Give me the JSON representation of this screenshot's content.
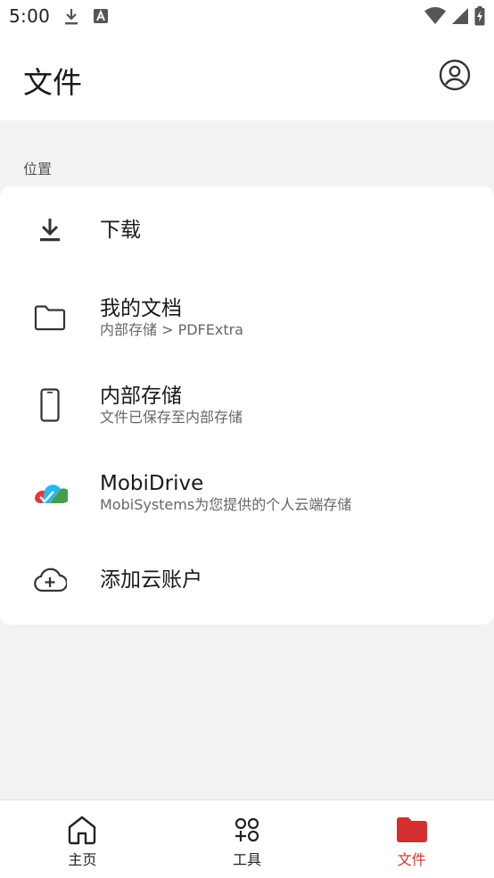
{
  "status_bar": {
    "time": "5:00",
    "icons": [
      "download-icon",
      "a-badge-icon",
      "wifi-icon",
      "signal-icon",
      "battery-charging-icon"
    ]
  },
  "app_bar": {
    "title": "文件",
    "account_icon": "account-circle-icon"
  },
  "locations": {
    "section_label": "位置",
    "items": [
      {
        "id": "downloads",
        "icon": "download-icon",
        "title": "下载",
        "subtitle": ""
      },
      {
        "id": "my-documents",
        "icon": "folder-icon",
        "title": "我的文档",
        "subtitle": "内部存储 > PDFExtra"
      },
      {
        "id": "internal-storage",
        "icon": "phone-icon",
        "title": "内部存储",
        "subtitle": "文件已保存至内部存储"
      },
      {
        "id": "mobidrive",
        "icon": "mobidrive-logo-icon",
        "title": "MobiDrive",
        "subtitle": "MobiSystems为您提供的个人云端存储"
      },
      {
        "id": "add-cloud",
        "icon": "cloud-add-icon",
        "title": "添加云账户",
        "subtitle": ""
      }
    ]
  },
  "bottom_nav": {
    "items": [
      {
        "id": "home",
        "icon": "home-icon",
        "label": "主页",
        "active": false
      },
      {
        "id": "tools",
        "icon": "tools-icon",
        "label": "工具",
        "active": false
      },
      {
        "id": "files",
        "icon": "folder-filled-icon",
        "label": "文件",
        "active": true
      }
    ],
    "active_color": "#d32f2f"
  }
}
